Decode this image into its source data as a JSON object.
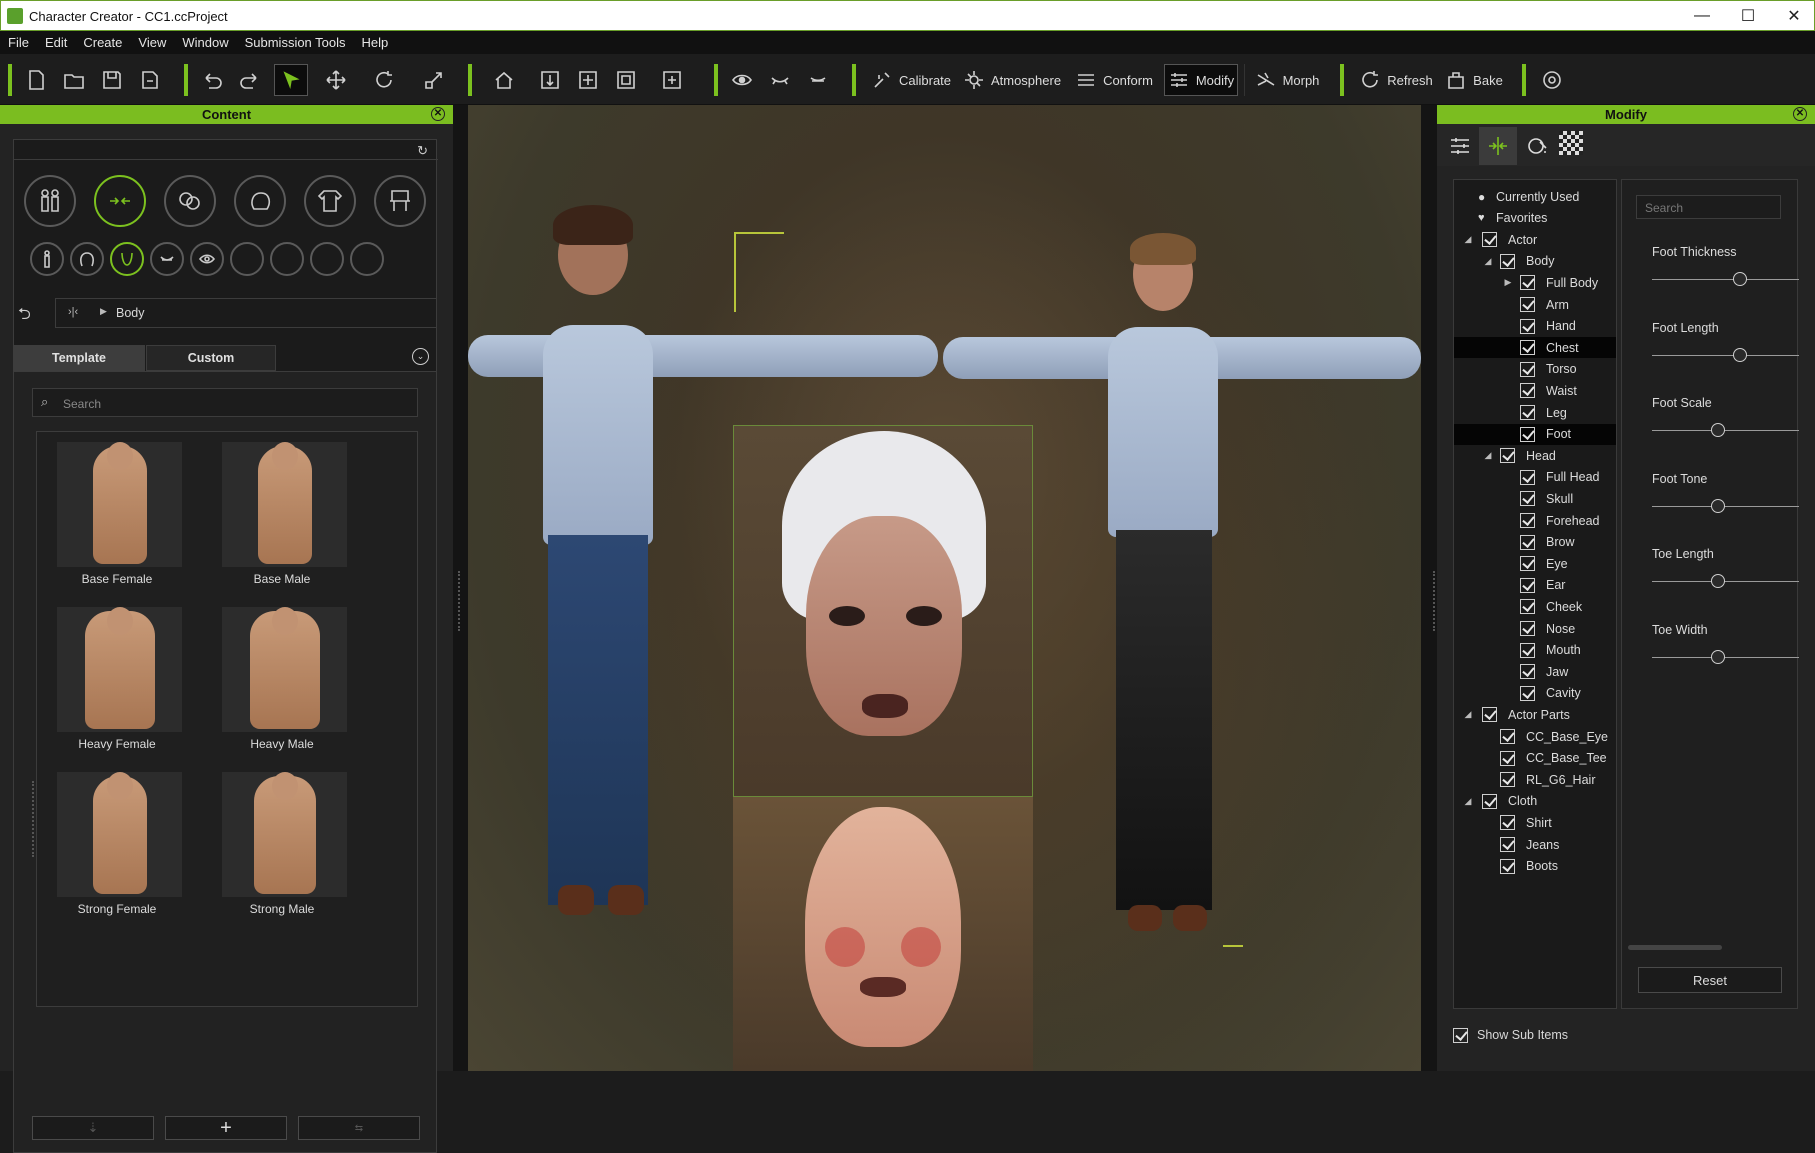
{
  "window": {
    "title": "Character Creator - CC1.ccProject",
    "minimize": "—",
    "maximize": "☐",
    "close": "✕"
  },
  "menu": [
    "File",
    "Edit",
    "Create",
    "View",
    "Window",
    "Submission Tools",
    "Help"
  ],
  "toolbar": {
    "calibrate": "Calibrate",
    "atmosphere": "Atmosphere",
    "conform": "Conform",
    "modify": "Modify",
    "morph": "Morph",
    "refresh": "Refresh",
    "bake": "Bake"
  },
  "content": {
    "header": "Content",
    "breadcrumb": "Body",
    "tabs": {
      "template": "Template",
      "custom": "Custom"
    },
    "search_placeholder": "Search",
    "items": [
      "Base Female",
      "Base Male",
      "Heavy Female",
      "Heavy Male",
      "Strong Female",
      "Strong Male"
    ],
    "add_button": "+"
  },
  "modify": {
    "header": "Modify",
    "tree": [
      {
        "label": "Currently Used",
        "kind": "bullet"
      },
      {
        "label": "Favorites",
        "kind": "heart"
      },
      {
        "label": "Actor",
        "kind": "check",
        "arrow": "open",
        "level": 0
      },
      {
        "label": "Body",
        "kind": "check",
        "arrow": "open",
        "level": 1
      },
      {
        "label": "Full Body",
        "kind": "check",
        "arrow": "closed",
        "level": 2
      },
      {
        "label": "Arm",
        "kind": "check",
        "level": 2
      },
      {
        "label": "Hand",
        "kind": "check",
        "level": 2
      },
      {
        "label": "Chest",
        "kind": "check",
        "level": 2,
        "selected": true
      },
      {
        "label": "Torso",
        "kind": "check",
        "level": 2
      },
      {
        "label": "Waist",
        "kind": "check",
        "level": 2
      },
      {
        "label": "Leg",
        "kind": "check",
        "level": 2
      },
      {
        "label": "Foot",
        "kind": "check",
        "level": 2,
        "selected": true
      },
      {
        "label": "Head",
        "kind": "check",
        "arrow": "open",
        "level": 1
      },
      {
        "label": "Full Head",
        "kind": "check",
        "level": 2
      },
      {
        "label": "Skull",
        "kind": "check",
        "level": 2
      },
      {
        "label": "Forehead",
        "kind": "check",
        "level": 2
      },
      {
        "label": "Brow",
        "kind": "check",
        "level": 2
      },
      {
        "label": "Eye",
        "kind": "check",
        "level": 2
      },
      {
        "label": "Ear",
        "kind": "check",
        "level": 2
      },
      {
        "label": "Cheek",
        "kind": "check",
        "level": 2
      },
      {
        "label": "Nose",
        "kind": "check",
        "level": 2
      },
      {
        "label": "Mouth",
        "kind": "check",
        "level": 2
      },
      {
        "label": "Jaw",
        "kind": "check",
        "level": 2
      },
      {
        "label": "Cavity",
        "kind": "check",
        "level": 2
      },
      {
        "label": "Actor Parts",
        "kind": "check",
        "arrow": "open",
        "level": 0
      },
      {
        "label": "CC_Base_Eye",
        "kind": "check",
        "level": 1
      },
      {
        "label": "CC_Base_Tee",
        "kind": "check",
        "level": 1
      },
      {
        "label": "RL_G6_Hair",
        "kind": "check",
        "level": 1
      },
      {
        "label": "Cloth",
        "kind": "check",
        "arrow": "open",
        "level": 0
      },
      {
        "label": "Shirt",
        "kind": "check",
        "level": 1
      },
      {
        "label": "Jeans",
        "kind": "check",
        "level": 1
      },
      {
        "label": "Boots",
        "kind": "check",
        "level": 1
      }
    ],
    "search_placeholder": "Search",
    "sliders": [
      {
        "label": "Foot Thickness",
        "value": 0.6
      },
      {
        "label": "Foot Length",
        "value": 0.6
      },
      {
        "label": "Foot Scale",
        "value": 0.45
      },
      {
        "label": "Foot Tone",
        "value": 0.45
      },
      {
        "label": "Toe Length",
        "value": 0.45
      },
      {
        "label": "Toe Width",
        "value": 0.45
      }
    ],
    "reset": "Reset",
    "show_sub_items": "Show Sub Items"
  },
  "colors": {
    "accent": "#7cc11f",
    "panel": "#232323",
    "selected": "#050505"
  }
}
